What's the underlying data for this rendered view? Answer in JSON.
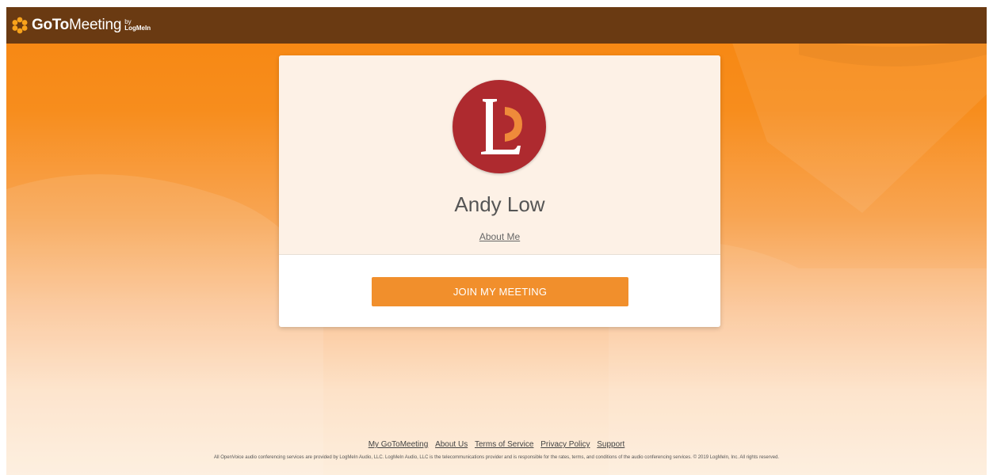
{
  "header": {
    "logo_goto": "GoTo",
    "logo_meeting": "Meeting",
    "logo_by": "by",
    "logo_by_brand": "LogMeIn",
    "logo_icon": "asterisk-flower-icon",
    "bar_color": "#6a3a12"
  },
  "card": {
    "avatar_initials": "LP",
    "name": "Andy Low",
    "about_link": "About Me",
    "join_button": "JOIN MY MEETING"
  },
  "footer": {
    "links": [
      "My GoToMeeting",
      "About Us",
      "Terms of Service",
      "Privacy Policy",
      "Support"
    ],
    "legal": "All OpenVoice audio conferencing services are provided by LogMeIn Audio, LLC. LogMeIn Audio, LLC is the telecommunications provider and is responsible for the rates, terms, and conditions of the audio conferencing services. © 2019 LogMeIn, Inc. All rights reserved."
  },
  "colors": {
    "accent_orange": "#f18f2c",
    "avatar_red": "#ae2a2f",
    "avatar_orange": "#ef8a3a"
  }
}
